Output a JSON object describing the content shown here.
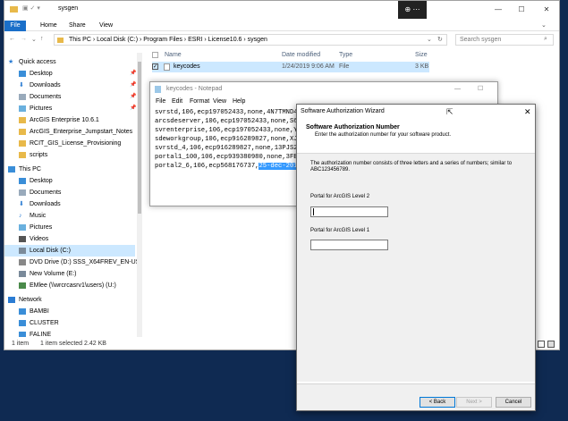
{
  "explorer": {
    "title": "sysgen",
    "ribbon_tabs": [
      "File",
      "Home",
      "Share",
      "View"
    ],
    "path": [
      "This PC",
      "Local Disk (C:)",
      "Program Files",
      "ESRI",
      "License10.6",
      "sysgen"
    ],
    "search_placeholder": "Search sysgen",
    "nav": {
      "quick_access": "Quick access",
      "quick_items": [
        "Desktop",
        "Downloads",
        "Documents",
        "Pictures",
        "ArcGIS Enterprise 10.6.1",
        "ArcGIS_Enterprise_Jumpstart_Notes",
        "RCIT_GIS_License_Provisioning",
        "scripts"
      ],
      "this_pc": "This PC",
      "pc_items": [
        "Desktop",
        "Documents",
        "Downloads",
        "Music",
        "Pictures",
        "Videos",
        "Local Disk (C:)",
        "DVD Drive (D:) SSS_X64FREV_EN-US_DV9",
        "New Volume (E:)",
        "EMlee (\\\\wrcrcasrv1\\users) (U:)"
      ],
      "network": "Network",
      "network_items": [
        "BAMBI",
        "CLUSTER",
        "FALINE"
      ]
    },
    "columns": [
      "Name",
      "Date modified",
      "Type",
      "Size"
    ],
    "file": {
      "name": "keycodes",
      "date": "1/24/2019 9:06 AM",
      "type": "File",
      "size": "3 KB"
    },
    "status_items": "1 item",
    "status_selected": "1 item selected  2.42 KB"
  },
  "notepad": {
    "title": "keycodes - Notepad",
    "menu": [
      "File",
      "Edit",
      "Format",
      "View",
      "Help"
    ],
    "lines": [
      "svrstd,106,ecp197052433,none,4N7TMND4",
      "arcsdeserver,106,ecp197052433,none,S6",
      "svrenterprise,106,ecp197052433,none,Y",
      "sdeworkgroup,106,ecp916289827,none,XJ",
      "svrstd_4,106,ecp916289827,none,13PJS2",
      "portal1_100,106,ecp939380980,none,3FB"
    ],
    "last_line_prefix": "portal2_6,106,ecp568176737,",
    "last_line_selected": "25-dec-201"
  },
  "wizard": {
    "title": "Software Authorization Wizard",
    "heading": "Software Authorization Number",
    "subheading": "Enter the authorization number for your software product.",
    "description": "The authorization number consists of three letters and a series of numbers; similar to ABC123456789.",
    "label_level2": "Portal for ArcGIS Level 2",
    "label_level1": "Portal for ArcGIS Level 1",
    "value_level2": "",
    "value_level1": "",
    "back": "< Back",
    "next": "Next >",
    "cancel": "Cancel"
  }
}
